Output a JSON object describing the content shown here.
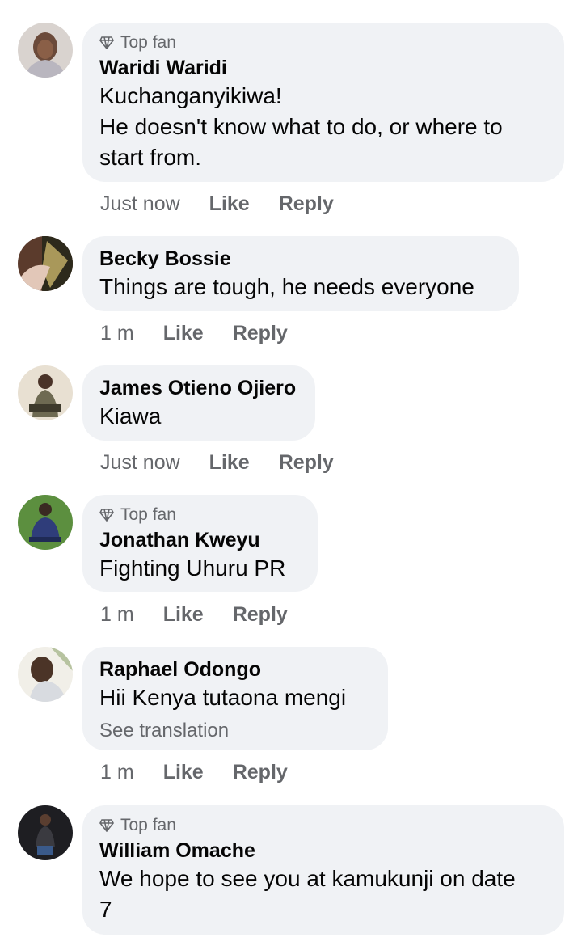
{
  "top_fan_label": "Top fan",
  "like_label": "Like",
  "reply_label": "Reply",
  "comments": [
    {
      "author": "Waridi Waridi",
      "top_fan": true,
      "text": "Kuchanganyikiwa!\nHe doesn't know what to do, or where to start from.",
      "time": "Just now"
    },
    {
      "author": "Becky Bossie",
      "top_fan": false,
      "text": "Things are tough, he needs everyone",
      "time": "1 m"
    },
    {
      "author": "James Otieno Ojiero",
      "top_fan": false,
      "text": "Kiawa",
      "time": "Just now"
    },
    {
      "author": "Jonathan Kweyu",
      "top_fan": true,
      "text": "Fighting Uhuru PR",
      "time": "1 m"
    },
    {
      "author": "Raphael Odongo",
      "top_fan": false,
      "text": "Hii Kenya tutaona mengi",
      "see_translation": "See translation",
      "time": "1 m"
    },
    {
      "author": "William Omache",
      "top_fan": true,
      "text": "We hope to see you at kamukunji on date\n7",
      "time": ""
    }
  ]
}
